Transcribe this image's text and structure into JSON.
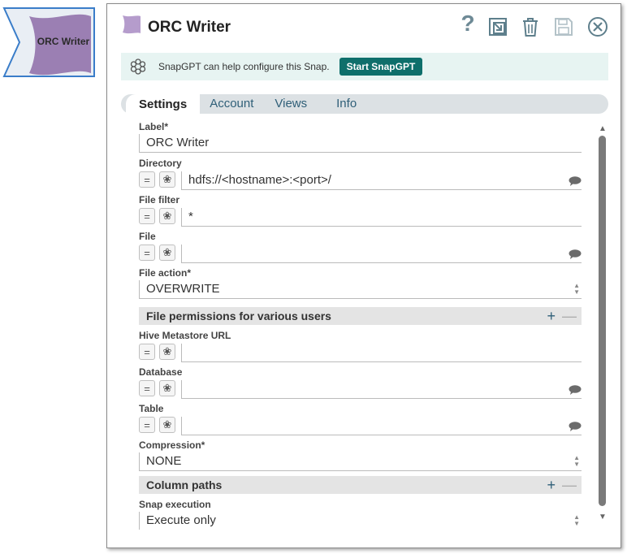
{
  "node": {
    "label": "ORC Writer"
  },
  "dialog": {
    "title": "ORC Writer",
    "help_glyph": "?"
  },
  "banner": {
    "text": "SnapGPT can help configure this Snap.",
    "button": "Start SnapGPT"
  },
  "tabs": [
    "Settings",
    "Account",
    "Views",
    "Info"
  ],
  "fields": {
    "label": {
      "label": "Label*",
      "value": "ORC Writer"
    },
    "directory": {
      "label": "Directory",
      "value": "hdfs://<hostname>:<port>/"
    },
    "file_filter": {
      "label": "File filter",
      "value": "*"
    },
    "file": {
      "label": "File",
      "value": ""
    },
    "file_action": {
      "label": "File action*",
      "value": "OVERWRITE"
    },
    "file_permissions": {
      "label": "File permissions for various users"
    },
    "hive_url": {
      "label": "Hive Metastore URL",
      "value": ""
    },
    "database": {
      "label": "Database",
      "value": ""
    },
    "table": {
      "label": "Table",
      "value": ""
    },
    "compression": {
      "label": "Compression*",
      "value": "NONE"
    },
    "column_paths": {
      "label": "Column paths"
    },
    "snap_execution": {
      "label": "Snap execution",
      "value": "Execute only"
    }
  },
  "colors": {
    "accent": "#0e6f6b",
    "node_fill": "#9b7fb3",
    "tab_text": "#2f5f78"
  }
}
